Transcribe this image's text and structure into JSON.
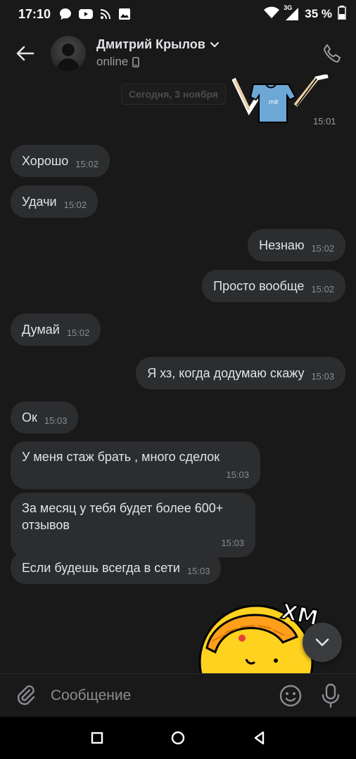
{
  "status_bar": {
    "time": "17:10",
    "network_label": "3G",
    "battery_percent": "35 %",
    "icons": [
      "chat-bubble-icon",
      "youtube-icon",
      "rss-icon",
      "image-icon",
      "wifi-icon",
      "signal-icon",
      "battery-icon"
    ]
  },
  "header": {
    "contact_name": "Дмитрий Крылов",
    "status": "online",
    "icons": [
      "back-arrow-icon",
      "chevron-down-icon",
      "mobile-icon",
      "phone-icon"
    ]
  },
  "chat": {
    "date_separator": "Сегодня, 3 ноября",
    "sticker_top_time": "15:01",
    "messages": [
      {
        "text": "Хорошо",
        "time": "15:02",
        "direction": "in"
      },
      {
        "text": "Удачи",
        "time": "15:02",
        "direction": "in"
      },
      {
        "text": "Незнаю",
        "time": "15:02",
        "direction": "out"
      },
      {
        "text": "Просто вообще",
        "time": "15:02",
        "direction": "out"
      },
      {
        "text": "Думай",
        "time": "15:02",
        "direction": "in"
      },
      {
        "text": "Я хз, когда додумаю скажу",
        "time": "15:03",
        "direction": "out"
      },
      {
        "text": "Ок",
        "time": "15:03",
        "direction": "in"
      },
      {
        "text": "У меня стаж брать , много сделок",
        "time": "15:03",
        "direction": "in"
      },
      {
        "text": "За месяц у тебя будет более 600+ отзывов",
        "time": "15:03",
        "direction": "in"
      },
      {
        "text": "Если будешь всегда в сети",
        "time": "15:03",
        "direction": "in"
      }
    ],
    "sticker_bottom_text": "ХМ"
  },
  "composer": {
    "placeholder": "Сообщение",
    "value": ""
  },
  "colors": {
    "background": "#19191a",
    "bubble": "#2c2d2f",
    "text": "#e1e3e6",
    "secondary": "#9a9c9f",
    "sticker_yellow": "#ffd21f"
  }
}
